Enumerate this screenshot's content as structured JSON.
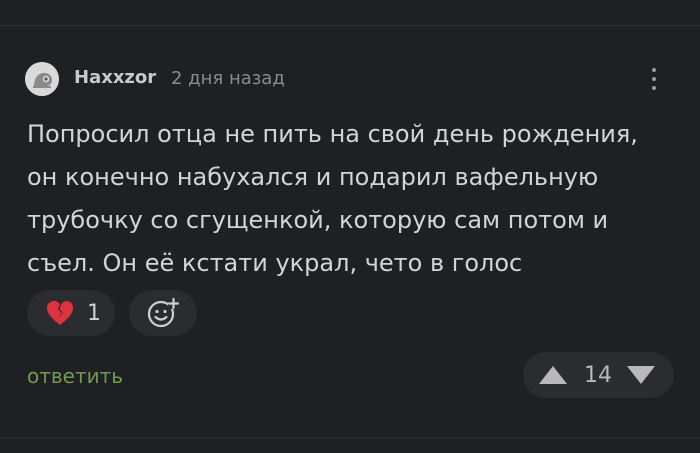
{
  "comment": {
    "author": "Haxxzor",
    "time_ago": "2 дня назад",
    "text_lines": [
      "Попросил отца не пить на свой день рождения,",
      "он конечно набухался и подарил вафельную",
      "трубочку со сгущенкой, которую сам потом и",
      "съел. Он её кстати украл, чето в голос"
    ],
    "reactions": [
      {
        "icon": "broken-heart-icon",
        "count": "1"
      }
    ],
    "add_reaction_icon": "smiley-plus-icon",
    "reply_label": "ответить",
    "rating": "14",
    "more_icon": "vertical-dots-icon"
  },
  "colors": {
    "background": "#1f2023",
    "pill": "#2b2c30",
    "reply": "#6f9b4f",
    "heart": "#e0313f"
  }
}
